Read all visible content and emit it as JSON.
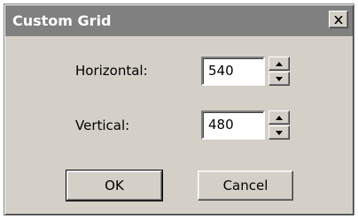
{
  "dialog": {
    "title": "Custom Grid",
    "close_icon": "close-icon"
  },
  "fields": {
    "horizontal": {
      "label": "Horizontal:",
      "value": "540"
    },
    "vertical": {
      "label": "Vertical:",
      "value": "480"
    }
  },
  "spinner_icons": {
    "up": "arrow-up-icon",
    "down": "arrow-down-icon"
  },
  "buttons": {
    "ok": "OK",
    "cancel": "Cancel"
  },
  "colors": {
    "titlebar": "#808080",
    "dialog_bg": "#d4d0c8"
  }
}
